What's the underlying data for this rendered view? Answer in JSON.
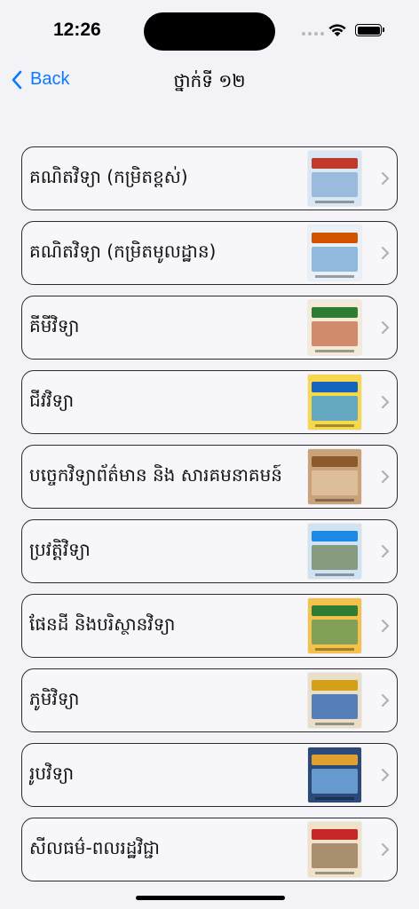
{
  "status": {
    "time": "12:26"
  },
  "nav": {
    "back_label": "Back",
    "title": "ថ្នាក់ទី ១២"
  },
  "items": [
    {
      "label": "គណិតវិទ្យា (កម្រិតខ្ពស់)",
      "cover": {
        "bg": "#d9e7f3",
        "band": "#c0392b",
        "art": "#8fb3d9"
      }
    },
    {
      "label": "គណិតវិទ្យា (កម្រិតមូលដ្ឋាន)",
      "cover": {
        "bg": "#e9f1f8",
        "band": "#d35400",
        "art": "#7fb0d8"
      }
    },
    {
      "label": "គីមីវិទ្យា",
      "cover": {
        "bg": "#f3ead8",
        "band": "#2e7d32",
        "art": "#c97a5a"
      }
    },
    {
      "label": "ជីវវិទ្យា",
      "cover": {
        "bg": "#f6d84a",
        "band": "#1565c0",
        "art": "#4aa0d6"
      }
    },
    {
      "label": "បច្ចេកវិទ្យាព័ត៌មាន និង សារគមនាគមន៍",
      "cover": {
        "bg": "#c9a27a",
        "band": "#8d5a2b",
        "art": "#e0c3a0"
      }
    },
    {
      "label": "ប្រវត្តិវិទ្យា",
      "cover": {
        "bg": "#cfe3f2",
        "band": "#1e88e5",
        "art": "#7a8f6a"
      }
    },
    {
      "label": "ផែនដី និងបរិស្ថានវិទ្យា",
      "cover": {
        "bg": "#f4c24a",
        "band": "#2e7d32",
        "art": "#6e9a5a"
      }
    },
    {
      "label": "ភូមិវិទ្យា",
      "cover": {
        "bg": "#e9dfc8",
        "band": "#d4a017",
        "art": "#3c6fb6"
      }
    },
    {
      "label": "រូបវិទ្យា",
      "cover": {
        "bg": "#2b4a7a",
        "band": "#e0a030",
        "art": "#6fa8dc"
      }
    },
    {
      "label": "សីលធម៌-ពលរដ្ឋវិជ្ជា",
      "cover": {
        "bg": "#f0e2c8",
        "band": "#c62828",
        "art": "#9a8060"
      }
    }
  ]
}
